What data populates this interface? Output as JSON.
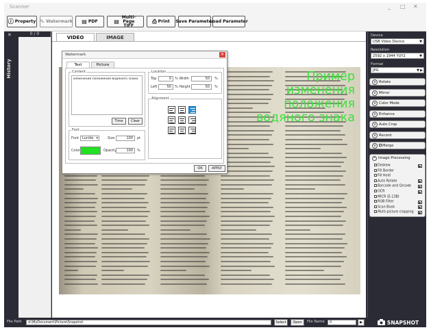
{
  "window": {
    "title": "Scanner",
    "controls": [
      "_",
      "□",
      "✕"
    ]
  },
  "toolbar": {
    "property": "Property",
    "watermark": "Watermark",
    "pdf": "PDF",
    "multipage_tiff": "Multi-Page TIFF",
    "print": "Print",
    "save_parameter": "Save Parameter",
    "load_parameter": "Load Parameter"
  },
  "sidebar": {
    "history_label": "History",
    "counter": "0 / 0",
    "close": "✕"
  },
  "viewer": {
    "tabs": [
      {
        "label": "VIDEO"
      },
      {
        "label": "IMAGE"
      }
    ],
    "watermark_lines": [
      "Пример",
      "изменения",
      "положения",
      "водяного знака"
    ]
  },
  "dialog": {
    "title": "Watermark",
    "tabs": [
      {
        "label": "Text"
      },
      {
        "label": "Picture"
      }
    ],
    "content_label": "Content",
    "content_text": "изменения положения водяного знака",
    "time_btn": "Time",
    "clear_btn": "Clear",
    "location_label": "Location",
    "top_label": "Top",
    "top_value": "0",
    "width_label": "% Width",
    "width_value": "50",
    "left_label": "Left",
    "left_value": "50",
    "height_label": "% Height",
    "height_value": "50",
    "pct": "%",
    "alignment_label": "Alignment",
    "font_label": "Font",
    "font_name_label": "Font",
    "font_name_value": "Lucida",
    "size_label": "Size",
    "size_value": "100",
    "size_unit": "pt",
    "color_label": "Color",
    "color_value": "#22e022",
    "opacity_label": "Opacity",
    "opacity_value": "100",
    "ok_btn": "OK",
    "apply_btn": "APPLY"
  },
  "rightpanel": {
    "device_label": "Device",
    "device_value": "USB Video Device",
    "resolution_label": "Resolution",
    "resolution_value": "2592 x 1944 YUY2",
    "format_label": "Format",
    "format_value": "JPG",
    "rows": [
      {
        "label": "Rotate"
      },
      {
        "label": "Mirror"
      },
      {
        "label": "Color Mode"
      },
      {
        "label": "Enhance"
      },
      {
        "label": "Auto Crop"
      },
      {
        "label": "Record"
      },
      {
        "label": "Merge"
      }
    ],
    "image_processing_label": "Image Processing",
    "ip_items": [
      {
        "label": "Deskew",
        "play": true
      },
      {
        "label": "Fill Border",
        "play": false
      },
      {
        "label": "Fill Hold",
        "play": false
      },
      {
        "label": "Auto Rotate",
        "play": true
      },
      {
        "label": "Barcode and Qrcode",
        "play": true
      },
      {
        "label": "OCR",
        "play": true
      },
      {
        "label": "MICR (E-13B)",
        "play": false
      },
      {
        "label": "ROB Filter",
        "play": true
      },
      {
        "label": "Scan Book",
        "play": true
      },
      {
        "label": "Multi-picture cropping",
        "play": true
      }
    ]
  },
  "statusbar": {
    "file_path_label": "File Path",
    "file_path_value": "d:\\MyDocument\\Picture\\Snapshot",
    "select_btn": "Select",
    "open_btn": "Open",
    "file_name_label": "File Name",
    "file_name_value": "0",
    "play_btn": "▶",
    "snapshot_label": "SNAPSHOT"
  }
}
